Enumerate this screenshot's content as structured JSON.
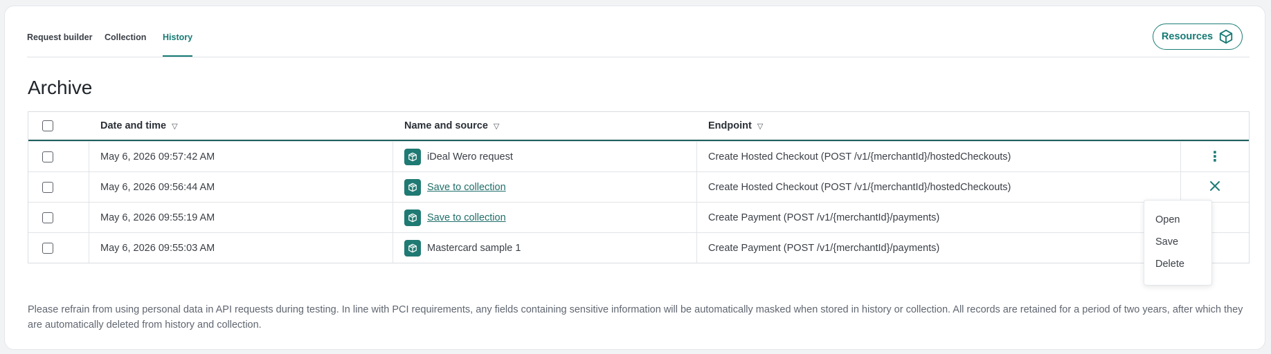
{
  "tabs": [
    {
      "label": "Request builder",
      "active": false
    },
    {
      "label": "Collection",
      "active": false
    },
    {
      "label": "History",
      "active": true
    }
  ],
  "resources_label": "Resources",
  "page_title": "Archive",
  "table": {
    "headers": {
      "date": "Date and time",
      "name": "Name and source",
      "endpoint": "Endpoint",
      "sort_icon": "▽"
    },
    "rows": [
      {
        "date": "May 6, 2026 09:57:42 AM",
        "name": "iDeal Wero request",
        "name_is_link": false,
        "endpoint": "Create Hosted Checkout (POST /v1/{merchantId}/hostedCheckouts)",
        "action": "more-vertical-icon"
      },
      {
        "date": "May 6, 2026 09:56:44 AM",
        "name": "Save to collection",
        "name_is_link": true,
        "endpoint": "Create Hosted Checkout (POST /v1/{merchantId}/hostedCheckouts)",
        "action": "close-icon"
      },
      {
        "date": "May 6, 2026 09:55:19 AM",
        "name": "Save to collection",
        "name_is_link": true,
        "endpoint": "Create Payment (POST /v1/{merchantId}/payments)",
        "action": ""
      },
      {
        "date": "May 6, 2026 09:55:03 AM",
        "name": "Mastercard sample 1",
        "name_is_link": false,
        "endpoint": "Create Payment (POST /v1/{merchantId}/payments)",
        "action": ""
      }
    ]
  },
  "row_menu": {
    "items": [
      "Open",
      "Save",
      "Delete"
    ]
  },
  "footer_text": "Please refrain from using personal data in API requests during testing. In line with PCI requirements, any fields containing sensitive information will be automatically masked when stored in history or collection. All records are retained for a period of two years, after which they are automatically deleted from history and collection.",
  "colors": {
    "accent": "#167a74",
    "header_rule": "#1b5f5b",
    "source_icon_bg": "#1f7a73"
  }
}
